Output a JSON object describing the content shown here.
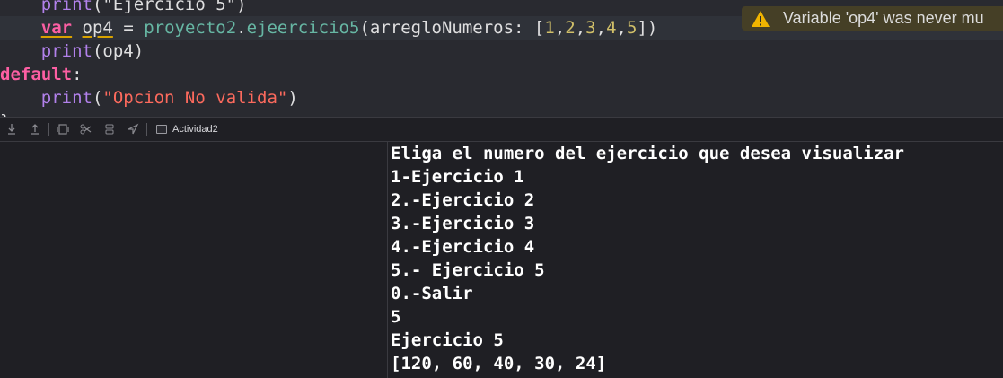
{
  "editor": {
    "lines": [
      {
        "tokens": [
          {
            "t": "    "
          },
          {
            "t": "print",
            "c": "fn"
          },
          {
            "t": "(\"Ejercicio 5\")",
            "c": "punc"
          }
        ]
      },
      {
        "tokens": [
          {
            "t": "    "
          },
          {
            "t": "var",
            "c": "kw",
            "u": true
          },
          {
            "t": " "
          },
          {
            "t": "op4",
            "c": "var",
            "u": true
          },
          {
            "t": " = "
          },
          {
            "t": "proyecto2",
            "c": "cls"
          },
          {
            "t": "."
          },
          {
            "t": "ejeercicio5",
            "c": "cls"
          },
          {
            "t": "(arregloNumeros: ["
          },
          {
            "t": "1",
            "c": "num"
          },
          {
            "t": ","
          },
          {
            "t": "2",
            "c": "num"
          },
          {
            "t": ","
          },
          {
            "t": "3",
            "c": "num"
          },
          {
            "t": ","
          },
          {
            "t": "4",
            "c": "num"
          },
          {
            "t": ","
          },
          {
            "t": "5",
            "c": "num"
          },
          {
            "t": "])"
          }
        ]
      },
      {
        "tokens": [
          {
            "t": "    "
          },
          {
            "t": "print",
            "c": "fn"
          },
          {
            "t": "(op4)"
          }
        ]
      },
      {
        "tokens": [
          {
            "t": "default",
            "c": "kw"
          },
          {
            "t": ":"
          }
        ]
      },
      {
        "tokens": [
          {
            "t": "    "
          },
          {
            "t": "print",
            "c": "fn"
          },
          {
            "t": "("
          },
          {
            "t": "\"Opcion No valida\"",
            "c": "str"
          },
          {
            "t": ")"
          }
        ]
      },
      {
        "tokens": [
          {
            "t": "}"
          }
        ]
      }
    ],
    "warning": {
      "icon": "warning-triangle-icon",
      "text": "Variable 'op4' was never mu"
    }
  },
  "debug_bar": {
    "buttons": [
      {
        "name": "step-into-icon"
      },
      {
        "name": "step-out-icon"
      },
      {
        "name": "view-debugger-icon"
      },
      {
        "name": "memory-graph-icon"
      },
      {
        "name": "environment-overrides-icon"
      },
      {
        "name": "simulate-location-icon"
      }
    ],
    "target_label": "Actividad2"
  },
  "console": {
    "lines": [
      "Eliga el numero del ejercicio que desea visualizar",
      "1-Ejercicio 1",
      "2.-Ejercicio 2",
      "3.-Ejercicio 3",
      "4.-Ejercicio 4",
      "5.- Ejercicio 5",
      "0.-Salir",
      "5",
      "Ejercicio 5",
      "[120, 60, 40, 30, 24]"
    ]
  },
  "colors": {
    "editor_bg": "#292a30",
    "console_bg": "#1f1f24",
    "warning_bg": "#453f26",
    "keyword": "#fc5fa3",
    "string": "#fc6a5d",
    "number": "#d0bf69"
  }
}
